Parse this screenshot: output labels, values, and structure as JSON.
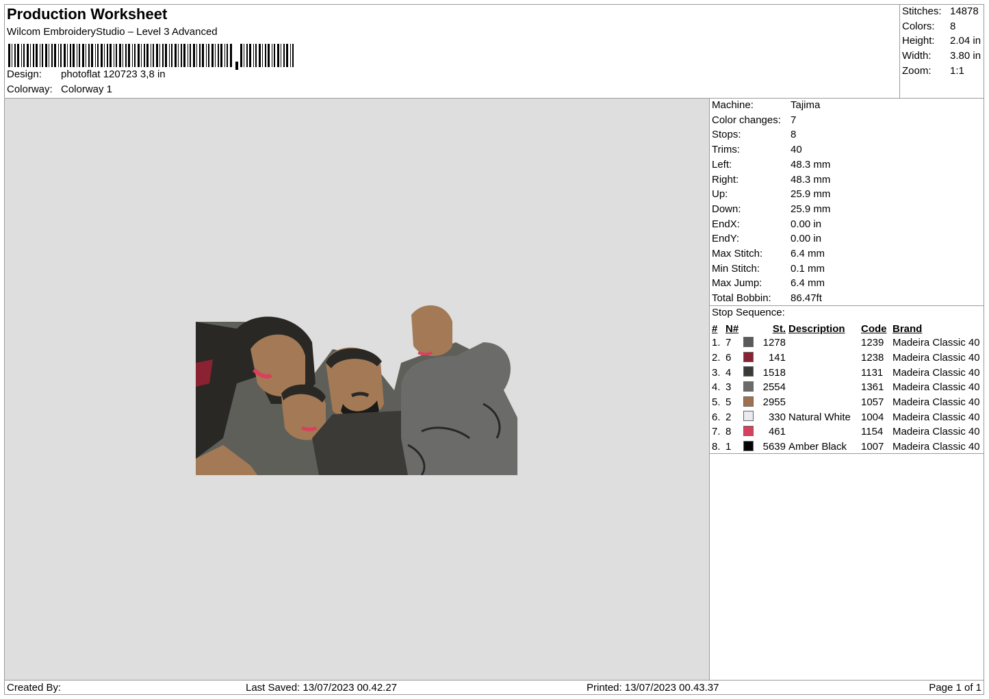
{
  "header": {
    "title": "Production Worksheet",
    "software": "Wilcom EmbroideryStudio – Level 3 Advanced",
    "design_label": "Design:",
    "design_value": "photoflat 120723 3,8 in",
    "colorway_label": "Colorway:",
    "colorway_value": "Colorway 1"
  },
  "stats": [
    {
      "label": "Stitches:",
      "value": "14878"
    },
    {
      "label": "Colors:",
      "value": "8"
    },
    {
      "label": "Height:",
      "value": "2.04 in"
    },
    {
      "label": "Width:",
      "value": "3.80 in"
    },
    {
      "label": "Zoom:",
      "value": "1:1"
    }
  ],
  "machine": [
    {
      "label": "Machine:",
      "value": "Tajima"
    },
    {
      "label": "Color changes:",
      "value": "7"
    },
    {
      "label": "Stops:",
      "value": "8"
    },
    {
      "label": "Trims:",
      "value": "40"
    },
    {
      "label": "Left:",
      "value": "48.3 mm"
    },
    {
      "label": "Right:",
      "value": "48.3 mm"
    },
    {
      "label": "Up:",
      "value": "25.9 mm"
    },
    {
      "label": "Down:",
      "value": "25.9 mm"
    },
    {
      "label": "EndX:",
      "value": "0.00 in"
    },
    {
      "label": "EndY:",
      "value": "0.00 in"
    },
    {
      "label": "Max Stitch:",
      "value": "6.4 mm"
    },
    {
      "label": "Min Stitch:",
      "value": "0.1 mm"
    },
    {
      "label": "Max Jump:",
      "value": "6.4 mm"
    },
    {
      "label": "Total Bobbin:",
      "value": "86.47ft"
    }
  ],
  "stop_sequence": {
    "title": "Stop Sequence:",
    "headers": {
      "hash": "#",
      "n": "N#",
      "st": "St.",
      "description": "Description",
      "code": "Code",
      "brand": "Brand"
    },
    "rows": [
      {
        "idx": "1.",
        "n": "7",
        "color": "#5a5a5a",
        "st": "1278",
        "description": "",
        "code": "1239",
        "brand": "Madeira Classic 40"
      },
      {
        "idx": "2.",
        "n": "6",
        "color": "#8b2232",
        "st": "141",
        "description": "",
        "code": "1238",
        "brand": "Madeira Classic 40"
      },
      {
        "idx": "3.",
        "n": "4",
        "color": "#3c3a37",
        "st": "1518",
        "description": "",
        "code": "1131",
        "brand": "Madeira Classic 40"
      },
      {
        "idx": "4.",
        "n": "3",
        "color": "#6b6b69",
        "st": "2554",
        "description": "",
        "code": "1361",
        "brand": "Madeira Classic 40"
      },
      {
        "idx": "5.",
        "n": "5",
        "color": "#a0714f",
        "st": "2955",
        "description": "",
        "code": "1057",
        "brand": "Madeira Classic 40"
      },
      {
        "idx": "6.",
        "n": "2",
        "color": "#ebebef",
        "st": "330",
        "description": "Natural White",
        "code": "1004",
        "brand": "Madeira Classic 40"
      },
      {
        "idx": "7.",
        "n": "8",
        "color": "#d8405c",
        "st": "461",
        "description": "",
        "code": "1154",
        "brand": "Madeira Classic 40"
      },
      {
        "idx": "8.",
        "n": "1",
        "color": "#050505",
        "st": "5639",
        "description": "Amber Black",
        "code": "1007",
        "brand": "Madeira Classic 40"
      }
    ]
  },
  "footer": {
    "created_by": "Created By:",
    "last_saved": "Last Saved: 13/07/2023 00.42.27",
    "printed": "Printed: 13/07/2023 00.43.37",
    "page": "Page 1 of 1"
  }
}
